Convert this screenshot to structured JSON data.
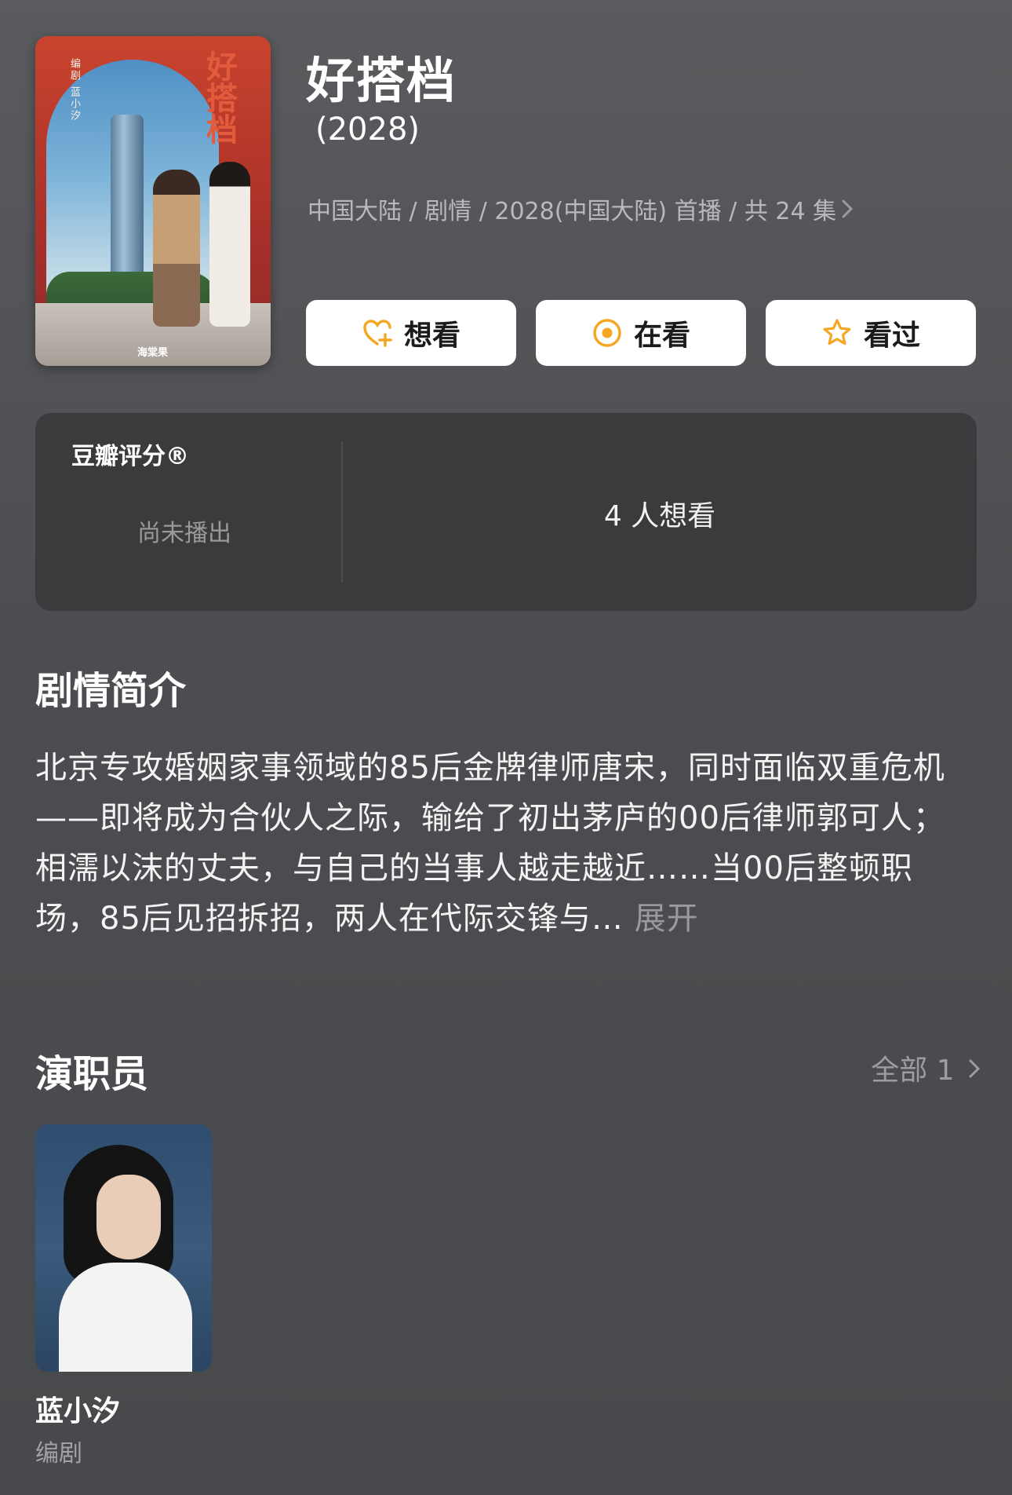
{
  "show": {
    "title": "好搭档",
    "year": "(2028)",
    "meta": "中国大陆 / 剧情 / 2028(中国大陆) 首播 / 共 24 集",
    "poster": {
      "title_vertical": "好搭档",
      "credit_vertical": "编剧 蓝小汐",
      "logo": "海棠果"
    }
  },
  "actions": {
    "want_label": "想看",
    "watching_label": "在看",
    "watched_label": "看过",
    "accent": "#f5a623"
  },
  "rating": {
    "label": "豆瓣评分®",
    "status": "尚未播出",
    "want_count_text": "4 人想看"
  },
  "synopsis": {
    "heading": "剧情简介",
    "text": "北京专攻婚姻家事领域的85后金牌律师唐宋，同时面临双重危机——即将成为合伙人之际，输给了初出茅庐的00后律师郭可人；相濡以沫的丈夫，与自己的当事人越走越近……当00后整顿职场，85后见招拆招，两人在代际交锋与…",
    "expand_label": "展开"
  },
  "cast": {
    "heading": "演职员",
    "all_label": "全部 1",
    "members": [
      {
        "name": "蓝小汐",
        "role": "编剧"
      }
    ]
  }
}
